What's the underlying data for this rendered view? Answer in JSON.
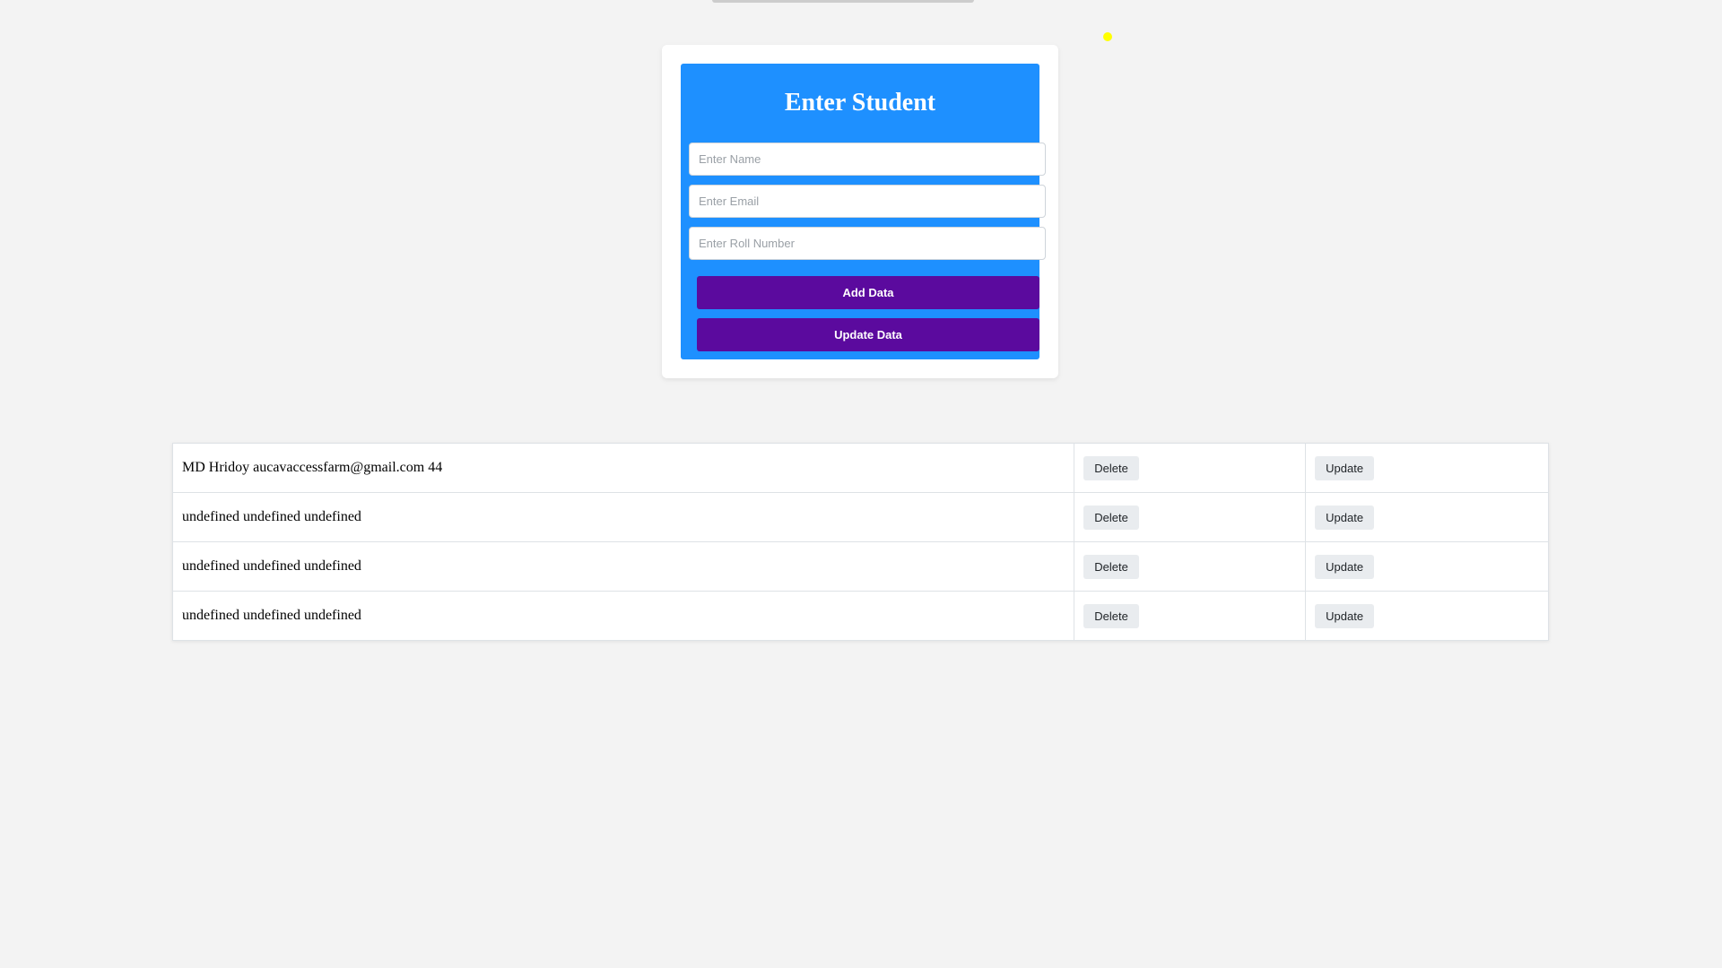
{
  "form": {
    "title": "Enter Student",
    "name_placeholder": "Enter Name",
    "email_placeholder": "Enter Email",
    "roll_placeholder": "Enter Roll Number",
    "add_button": "Add Data",
    "update_button": "Update Data"
  },
  "table": {
    "rows": [
      {
        "text": "MD Hridoy aucavaccessfarm@gmail.com 44",
        "delete_label": "Delete",
        "update_label": "Update"
      },
      {
        "text": "undefined undefined undefined",
        "delete_label": "Delete",
        "update_label": "Update"
      },
      {
        "text": "undefined undefined undefined",
        "delete_label": "Delete",
        "update_label": "Update"
      },
      {
        "text": "undefined undefined undefined",
        "delete_label": "Delete",
        "update_label": "Update"
      }
    ]
  }
}
